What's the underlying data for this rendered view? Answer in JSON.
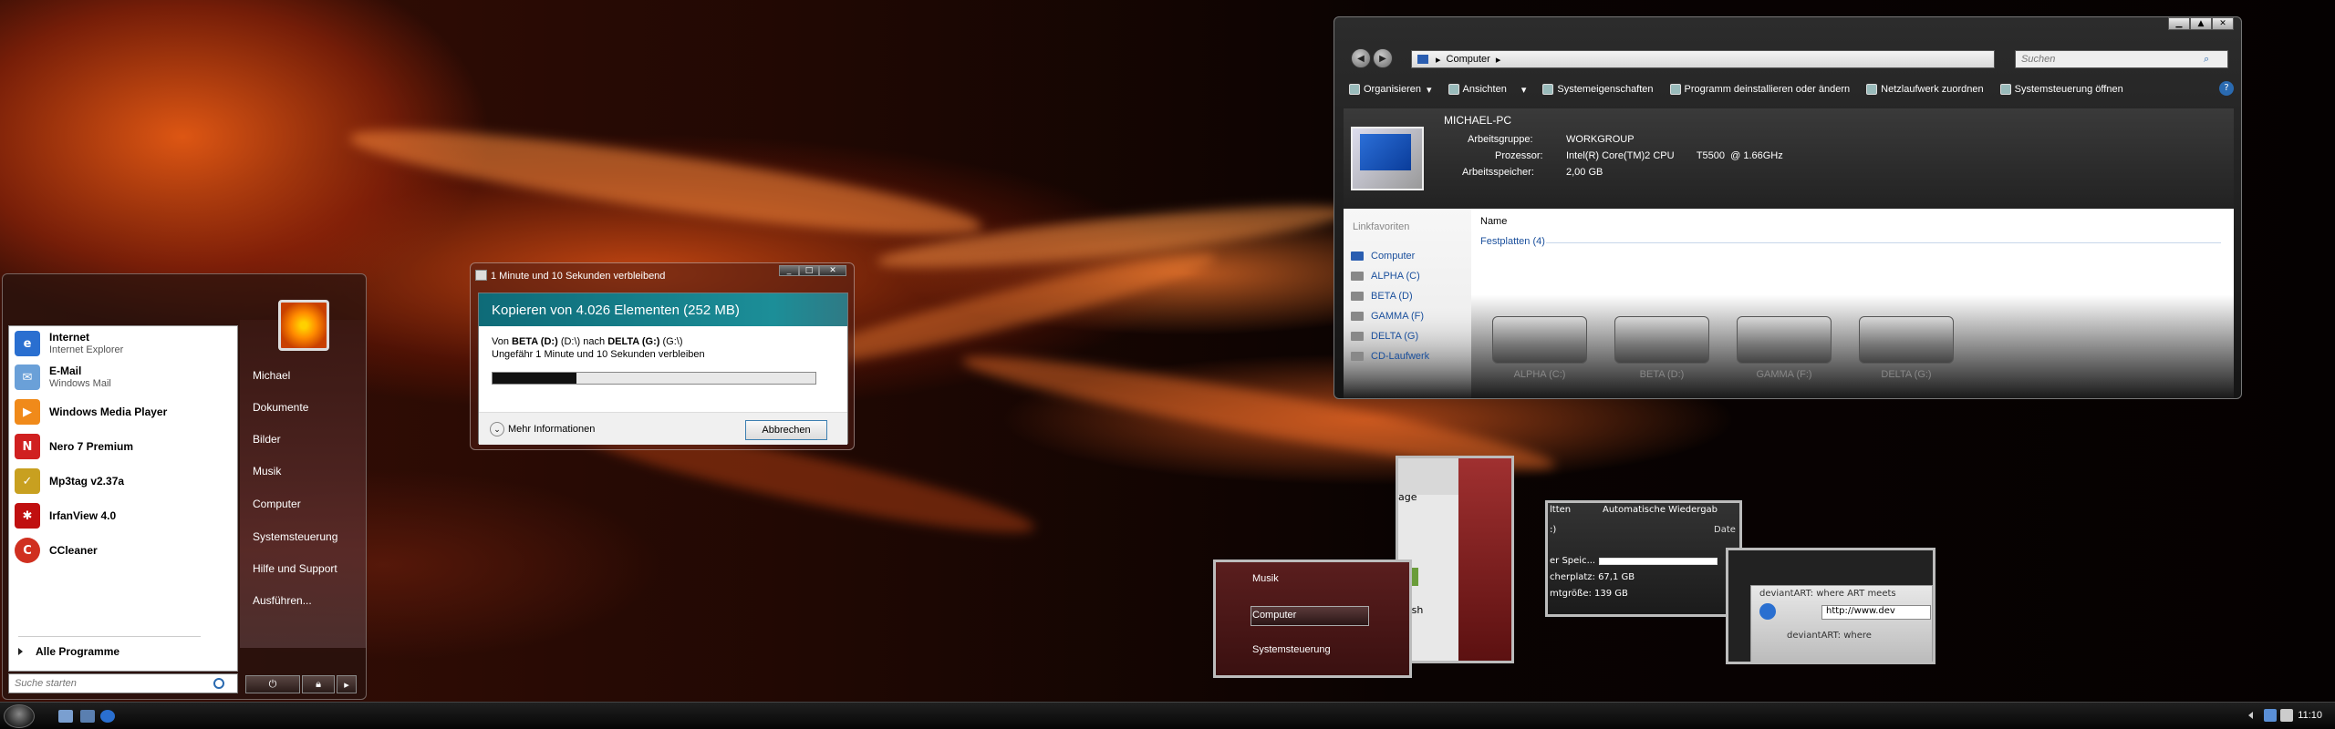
{
  "start_menu": {
    "programs": [
      {
        "name": "Internet",
        "sub": "Internet Explorer",
        "icon": "internet-explorer-icon"
      },
      {
        "name": "E-Mail",
        "sub": "Windows Mail",
        "icon": "mail-icon"
      },
      {
        "name": "Windows Media Player",
        "sub": "",
        "icon": "media-player-icon"
      },
      {
        "name": "Nero 7 Premium",
        "sub": "",
        "icon": "nero-icon"
      },
      {
        "name": "Mp3tag v2.37a",
        "sub": "",
        "icon": "mp3tag-icon"
      },
      {
        "name": "IrfanView 4.0",
        "sub": "",
        "icon": "irfanview-icon"
      },
      {
        "name": "CCleaner",
        "sub": "",
        "icon": "ccleaner-icon"
      }
    ],
    "all_programs": "Alle Programme",
    "search_placeholder": "Suche starten",
    "right": [
      "Michael",
      "Dokumente",
      "Bilder",
      "Musik",
      "Computer",
      "Systemsteuerung",
      "Hilfe und Support",
      "Ausführen..."
    ]
  },
  "copy_dialog": {
    "title": "1 Minute und 10 Sekunden verbleibend",
    "header": "Kopieren von 4.026 Elementen (252 MB)",
    "from_label": "Von",
    "from_drive": "BETA (D:)",
    "from_path": "(D:\\)",
    "to_label": "nach",
    "to_drive": "DELTA (G:)",
    "to_path": "(G:\\)",
    "remaining": "Ungefähr 1 Minute und 10 Sekunden verbleiben",
    "progress": 0.26,
    "more_info": "Mehr Informationen",
    "cancel": "Abbrechen"
  },
  "explorer": {
    "address": "Computer",
    "search_placeholder": "Suchen",
    "toolbar": [
      "Organisieren",
      "Ansichten",
      "Systemeigenschaften",
      "Programm deinstallieren oder ändern",
      "Netzlaufwerk zuordnen",
      "Systemsteuerung öffnen"
    ],
    "pc_name": "MICHAEL-PC",
    "info": [
      {
        "label": "Arbeitsgruppe:",
        "value": "WORKGROUP"
      },
      {
        "label": "Prozessor:",
        "value": "Intel(R) Core(TM)2 CPU        T5500  @ 1.66GHz"
      },
      {
        "label": "Arbeitsspeicher:",
        "value": "2,00 GB"
      }
    ],
    "nav_heading": "Linkfavoriten",
    "nav": [
      "Computer",
      "ALPHA (C)",
      "BETA (D)",
      "GAMMA (F)",
      "DELTA (G)",
      "CD-Laufwerk"
    ],
    "column": "Name",
    "group": "Festplatten (4)",
    "drives": [
      "ALPHA (C:)",
      "BETA (D:)",
      "GAMMA (F:)",
      "DELTA (G:)"
    ]
  },
  "flip": {
    "t1": [
      "Musik",
      "Computer",
      "Systemsteuerung"
    ],
    "t2": [
      "age",
      "Fish"
    ],
    "t3": [
      "ltten",
      "Automatische Wiedergab",
      ":)",
      "Date",
      "er Speic...",
      "cherplatz: 67,1 GB",
      "mtgröße: 139 GB"
    ],
    "t4": [
      "deviantART: where ART meets",
      "http://www.dev",
      "deviantART: where"
    ]
  },
  "taskbar": {
    "clock": "11:10"
  }
}
